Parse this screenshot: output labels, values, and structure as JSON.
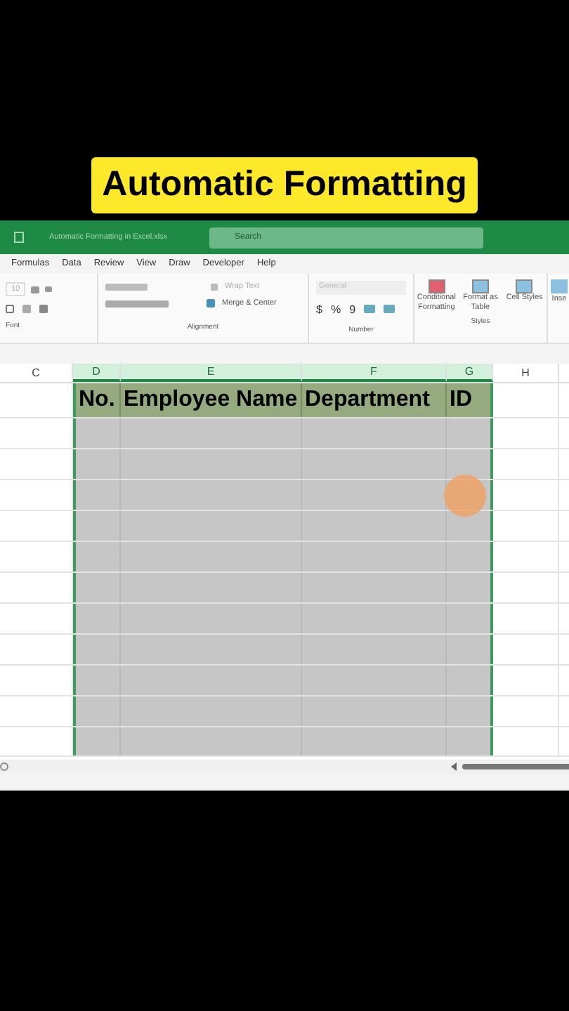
{
  "caption": "Automatic Formatting",
  "title_bar": {
    "file_name": "Automatic Formatting in Excel.xlsx",
    "search": {
      "placeholder": "Search"
    }
  },
  "menu": [
    "Formulas",
    "Data",
    "Review",
    "View",
    "Draw",
    "Developer",
    "Help"
  ],
  "ribbon": {
    "font_size": "10",
    "wrap_text": "Wrap Text",
    "merge": "Merge & Center",
    "number_format": "General",
    "currency": "$",
    "percent": "%",
    "comma": "9",
    "styles": [
      {
        "label": "Conditional Formatting"
      },
      {
        "label": "Format as Table"
      },
      {
        "label": "Cell Styles"
      }
    ],
    "insert": "Inse",
    "groups": [
      "Font",
      "Alignment",
      "Number",
      "Styles"
    ]
  },
  "columns": [
    {
      "label": "C",
      "selected": false
    },
    {
      "label": "D",
      "selected": true
    },
    {
      "label": "E",
      "selected": true
    },
    {
      "label": "F",
      "selected": true
    },
    {
      "label": "G",
      "selected": true
    },
    {
      "label": "H",
      "selected": false
    }
  ],
  "table_header": [
    "No.",
    "Employee Name",
    "Department",
    "ID"
  ]
}
